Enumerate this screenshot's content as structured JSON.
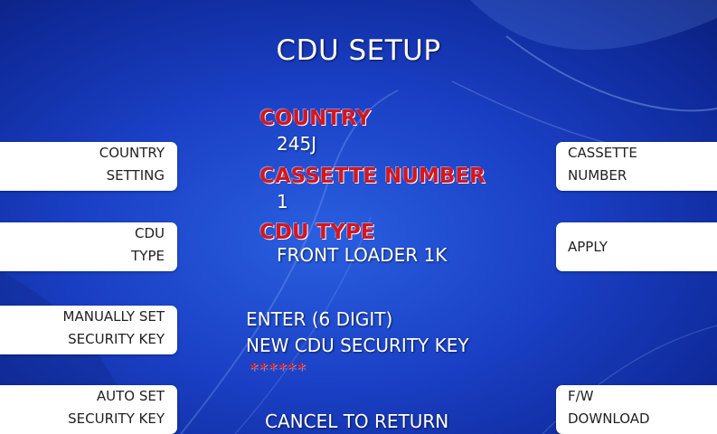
{
  "screen": {
    "title": "CDU SETUP",
    "fields": {
      "country_label": "COUNTRY",
      "country_value": "245J",
      "cassette_label": "CASSETTE NUMBER",
      "cassette_value": "1",
      "cdu_type_label": "CDU TYPE",
      "cdu_type_value": "FRONT LOADER 1K"
    },
    "prompt": {
      "line1": "ENTER (6 DIGIT)",
      "line2": "NEW CDU SECURITY KEY",
      "masked_input": "******"
    },
    "cancel_text": "CANCEL TO RETURN"
  },
  "left_buttons": [
    {
      "line1": "COUNTRY",
      "line2": "SETTING"
    },
    {
      "line1": "CDU",
      "line2": "TYPE"
    },
    {
      "line1": "MANUALLY SET",
      "line2": "SECURITY KEY"
    },
    {
      "line1": "AUTO SET",
      "line2": "SECURITY KEY"
    }
  ],
  "right_buttons": [
    {
      "line1": "CASSETTE",
      "line2": "NUMBER"
    },
    {
      "line1": "APPLY",
      "line2": ""
    },
    {
      "line1": "F/W",
      "line2": "DOWNLOAD"
    }
  ],
  "colors": {
    "background": "#1a3fc4",
    "label_red": "#d8151b",
    "button_bg": "#ffffff"
  }
}
